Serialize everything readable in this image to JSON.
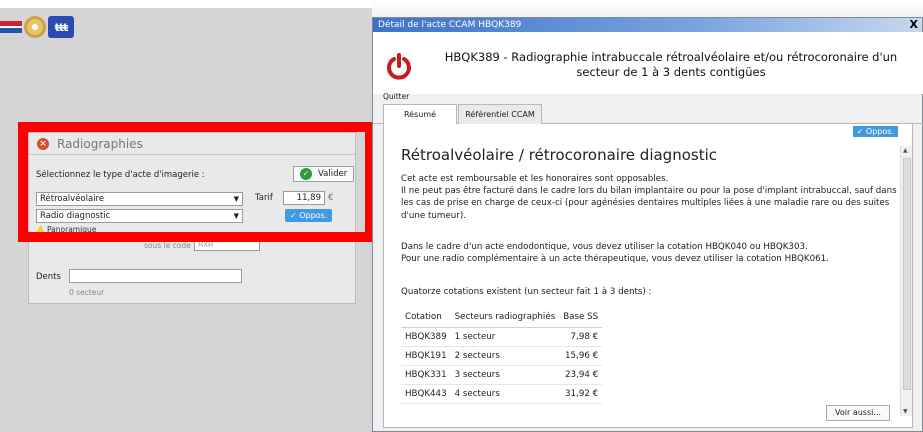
{
  "left_panel": {
    "title": "Radiographies",
    "prompt": "Sélectionnez le type d'acte d'imagerie :",
    "validate_label": "Valider",
    "type_select": "Rétroalvéolaire",
    "subtype_select": "Radio diagnostic",
    "tarif_label": "Tarif",
    "tarif_value": "11,89",
    "currency": "€",
    "oppos_label": "✓ Oppos.",
    "hidden_line_1": "Panoramique",
    "hidden_line_2": "sous le code",
    "hidden_code": "HXH",
    "dents_label": "Dents",
    "dents_value": "",
    "secteur_text": "0 secteur"
  },
  "ccam_window": {
    "title": "Détail de l'acte CCAM HBQK389",
    "close_glyph": "X",
    "header_title": "HBQK389 - Radiographie intrabuccale rétroalvéolaire et/ou rétrocoronaire d'un secteur de 1 à 3 dents contigües",
    "quit_label": "Quitter",
    "tabs": [
      "Résumé",
      "Référentiel CCAM"
    ],
    "oppos_badge": "✓ Oppos.",
    "section_title": "Rétroalvéolaire / rétrocoronaire diagnostic",
    "para1": "Cet acte est remboursable et les honoraires sont opposables.",
    "para2": "Il ne peut pas être facturé dans le cadre lors du bilan implantaire ou pour la pose d'implant intrabuccal, sauf dans les cas de prise en charge de ceux-ci (pour agénésies dentaires multiples liées à une maladie rare ou des suites d'une tumeur).",
    "para3": "Dans le cadre d'un acte endodontique, vous devez utiliser la cotation HBQK040 ou HBQK303.",
    "para4": "Pour une radio complémentaire à un acte thérapeutique, vous devez utiliser la cotation HBQK061.",
    "table_intro": "Quatorze cotations existent (un secteur fait 1 à 3 dents) :",
    "table_headers": [
      "Cotation",
      "Secteurs radiographiés",
      "Base SS"
    ],
    "table_rows": [
      [
        "HBQK389",
        "1 secteur",
        "7,98 €"
      ],
      [
        "HBQK191",
        "2 secteurs",
        "15,96 €"
      ],
      [
        "HBQK331",
        "3 secteurs",
        "23,94 €"
      ],
      [
        "HBQK443",
        "4 secteurs",
        "31,92 €"
      ]
    ],
    "voir_aussi": "Voir aussi..."
  },
  "colors": {
    "highlight_frame": "#ff0000",
    "oppos_blue": "#3f9ae0",
    "validate_green": "#2e9a3a",
    "quit_red": "#cc1a1a"
  },
  "icons": [
    "flag-icon",
    "cd-icon",
    "family-icon",
    "close-circle-icon",
    "check-icon",
    "power-icon",
    "warning-icon"
  ]
}
